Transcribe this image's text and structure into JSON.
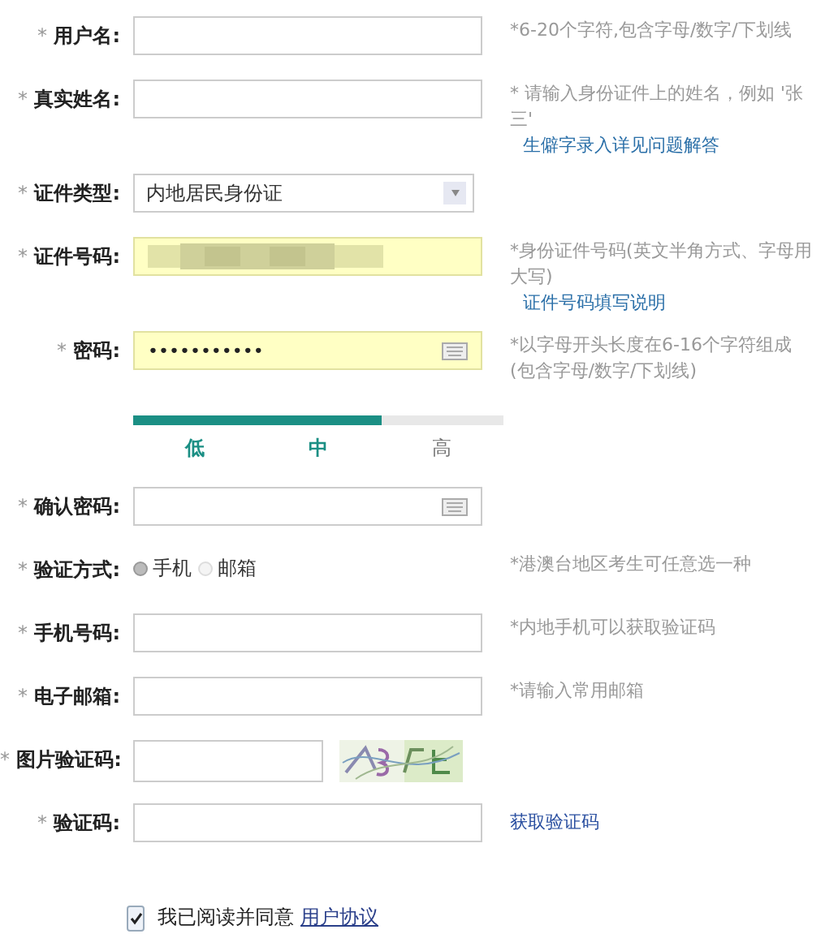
{
  "required_mark": "*",
  "fields": [
    {
      "kind": "text",
      "label": "用户名:",
      "highlighted": false,
      "hint": "*6-20个字符,包含字母/数字/下划线"
    },
    {
      "kind": "text",
      "label": "真实姓名:",
      "highlighted": false,
      "hint": "* 请输入身份证件上的姓名，例如 '张三'",
      "link": "生僻字录入详见问题解答"
    },
    {
      "kind": "select",
      "label": "证件类型:",
      "value": "内地居民身份证",
      "highlighted": false
    },
    {
      "kind": "masked",
      "label": "证件号码:",
      "highlighted": true,
      "hint": "*身份证件号码(英文半角方式、字母用大写)",
      "link": "证件号码填写说明"
    },
    {
      "kind": "password",
      "label": "密码:",
      "value": "•••••••••••",
      "highlighted": true,
      "hint": "*以字母开头长度在6-16个字符组成(包含字母/数字/下划线)",
      "strength": {
        "level": 0.67,
        "labels": [
          {
            "text": "低",
            "active": true
          },
          {
            "text": "中",
            "active": true
          },
          {
            "text": "高",
            "active": false
          }
        ]
      }
    },
    {
      "kind": "password",
      "label": "确认密码:",
      "highlighted": false
    },
    {
      "kind": "radio",
      "label": "验证方式:",
      "options": [
        {
          "text": "手机",
          "selected": true
        },
        {
          "text": "邮箱",
          "selected": false
        }
      ],
      "hint": "*港澳台地区考生可任意选一种"
    },
    {
      "kind": "text",
      "label": "手机号码:",
      "highlighted": false,
      "hint": "*内地手机可以获取验证码"
    },
    {
      "kind": "text",
      "label": "电子邮箱:",
      "highlighted": false,
      "hint": "*请输入常用邮箱"
    },
    {
      "kind": "captcha",
      "label": "图片验证码:",
      "highlighted": false
    },
    {
      "kind": "text",
      "label": "验证码:",
      "highlighted": false,
      "action": "获取验证码"
    }
  ],
  "agreement": {
    "checked": true,
    "text": "我已阅读并同意",
    "link": "用户协议"
  }
}
